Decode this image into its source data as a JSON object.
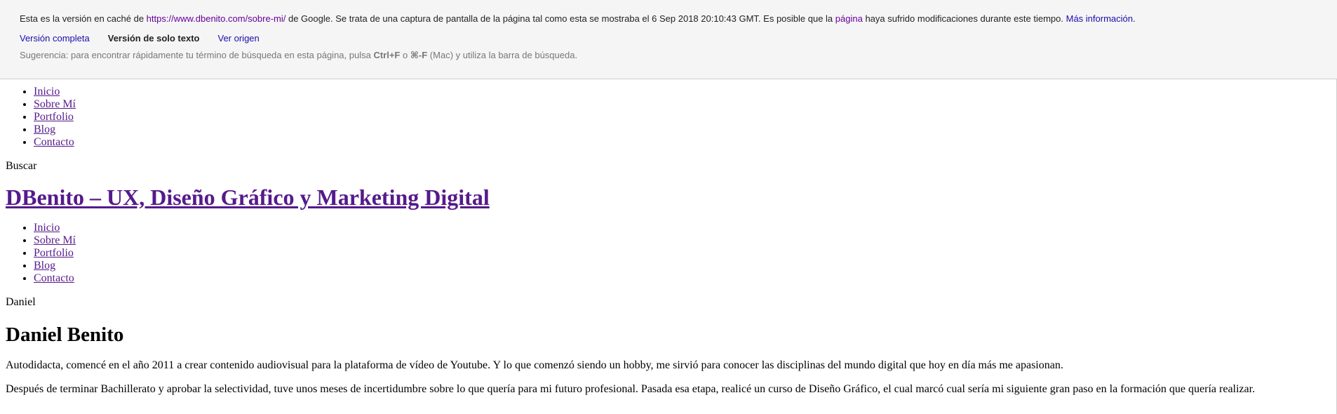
{
  "cache_header": {
    "intro_before_url": "Esta es la versión en caché de ",
    "cached_url": "https://www.dbenito.com/sobre-mi/",
    "intro_after_url": " de Google. Se trata de una captura de pantalla de la página tal como esta se mostraba el 6 Sep 2018 20:10:43 GMT. Es posible que la ",
    "page_link": "página",
    "intro_tail": " haya sufrido modificaciones durante este tiempo. ",
    "more_info_link": "Más información",
    "intro_end": ".",
    "links": {
      "full_version": "Versión completa",
      "text_only": "Versión de solo texto",
      "view_source": "Ver origen"
    },
    "tip_before": "Sugerencia: para encontrar rápidamente tu término de búsqueda en esta página, pulsa ",
    "tip_key1": "Ctrl+F",
    "tip_middle": " o ",
    "tip_key2": "⌘-F",
    "tip_after": " (Mac) y utiliza la barra de búsqueda."
  },
  "nav_top": {
    "items": [
      {
        "label": "Inicio"
      },
      {
        "label": "Sobre Mí"
      },
      {
        "label": "Portfolio"
      },
      {
        "label": "Blog"
      },
      {
        "label": "Contacto"
      }
    ]
  },
  "search_label": "Buscar",
  "site_title": "DBenito – UX, Diseño Gráfico y Marketing Digital",
  "nav_secondary": {
    "items": [
      {
        "label": "Inicio"
      },
      {
        "label": "Sobre Mí"
      },
      {
        "label": "Portfolio"
      },
      {
        "label": "Blog"
      },
      {
        "label": "Contacto"
      }
    ]
  },
  "image_alt_label": "Daniel",
  "page_heading": "Daniel Benito",
  "paragraphs": [
    "Autodidacta, comencé en el año 2011 a crear contenido audiovisual para la plataforma de vídeo de Youtube. Y lo que comenzó siendo un hobby, me sirvió para conocer las disciplinas del mundo digital que hoy en día más me apasionan.",
    "Después de terminar Bachillerato y aprobar la selectividad, tuve unos meses de incertidumbre sobre lo que quería para mi futuro profesional. Pasada esa etapa, realicé un curso de Diseño Gráfico, el cual marcó cual sería mi siguiente gran paso en la formación que quería realizar."
  ]
}
